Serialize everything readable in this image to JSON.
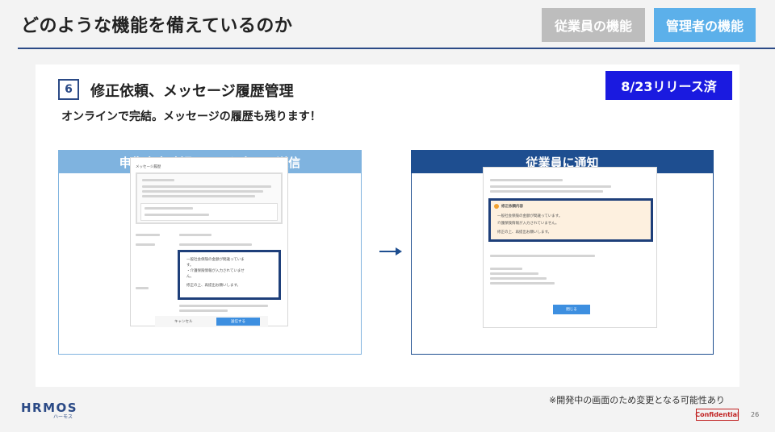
{
  "header": {
    "title": "どのような機能を備えているのか",
    "nav": {
      "employee": "従業員の機能",
      "admin": "管理者の機能"
    }
  },
  "section": {
    "number": "6",
    "title": "修正依頼、メッセージ履歴管理",
    "subtitle": "オンラインで完結。メッセージの履歴も残ります！",
    "release_badge": "8/23リリース済"
  },
  "panel_left": {
    "title": "申告内容確認画面で入力して送信",
    "history_heading": "メッセージ履歴",
    "message_lines": [
      "一般社会保険の金額が間違っていま",
      "す。",
      "・介護保険情報が入力されていませ",
      "ん。",
      "修正の上、再提出お願いします。"
    ],
    "cancel_label": "キャンセル",
    "send_label": "送信する"
  },
  "panel_right": {
    "title": "従業員に通知",
    "notice_heading": "修正依頼内容",
    "notice_lines": [
      "一般社会保険の金額が間違っています。",
      "介護保険情報が入力されていません。",
      "修正の上、再提出お願いします。"
    ],
    "close_label": "閉じる"
  },
  "footer": {
    "note": "※開発中の画面のため変更となる可能性あり",
    "confidential": "Confidential",
    "page": "26",
    "logo": "HRMOS",
    "logo_sub": "ハーモス"
  },
  "colors": {
    "navy": "#2b4a86",
    "release": "#1a1ae0",
    "light_blue": "#7fb3df",
    "dark_blue": "#1e4e90"
  }
}
